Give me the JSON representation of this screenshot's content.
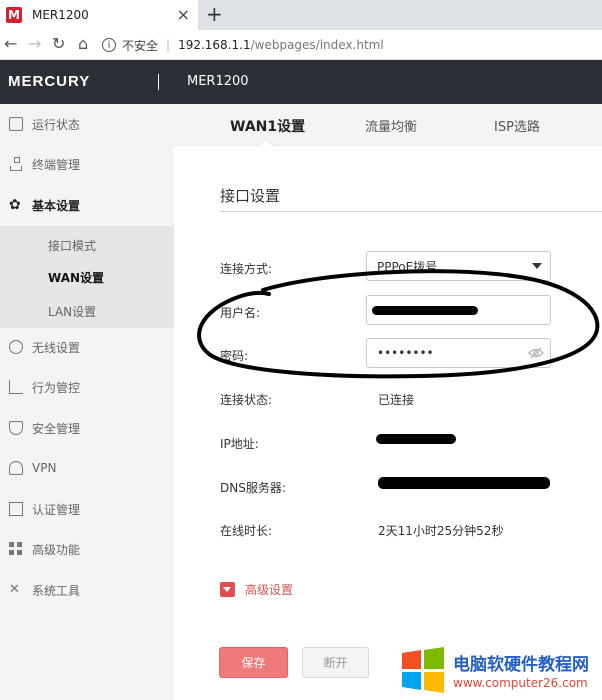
{
  "browser": {
    "tab_title": "MER1200",
    "tab_favicon": "M",
    "close_glyph": "×",
    "new_tab_glyph": "+",
    "security_label": "不安全",
    "url_host": "192.168.1.1",
    "url_path": "/webpages/index.html"
  },
  "header": {
    "logo": "MERCURY",
    "model": "MER1200"
  },
  "sidebar": {
    "items": [
      {
        "label": "运行状态",
        "icon": "monitor-icon"
      },
      {
        "label": "终端管理",
        "icon": "network-icon"
      },
      {
        "label": "基本设置",
        "icon": "gear-icon"
      },
      {
        "label": "无线设置",
        "icon": "wifi-icon"
      },
      {
        "label": "行为管控",
        "icon": "chart-icon"
      },
      {
        "label": "安全管理",
        "icon": "shield-icon"
      },
      {
        "label": "VPN",
        "icon": "vpn-icon"
      },
      {
        "label": "认证管理",
        "icon": "auth-icon"
      },
      {
        "label": "高级功能",
        "icon": "grid-icon"
      },
      {
        "label": "系统工具",
        "icon": "tools-icon"
      }
    ],
    "subitems": [
      {
        "label": "接口模式"
      },
      {
        "label": "WAN设置"
      },
      {
        "label": "LAN设置"
      }
    ]
  },
  "content_tabs": [
    {
      "label": "WAN1设置"
    },
    {
      "label": "流量均衡"
    },
    {
      "label": "ISP选路"
    }
  ],
  "form": {
    "section_title": "接口设置",
    "connection_type_label": "连接方式:",
    "connection_type_value": "PPPoE拨号",
    "username_label": "用户名:",
    "password_label": "密码:",
    "password_value": "••••••••",
    "status_label": "连接状态:",
    "status_value": "已连接",
    "ip_label": "IP地址:",
    "dns_label": "DNS服务器:",
    "uptime_label": "在线时长:",
    "uptime_value": "2天11小时25分钟52秒",
    "advanced_label": "高级设置",
    "save_label": "保存",
    "disconnect_label": "断开"
  },
  "watermark": {
    "text": "电脑软硬件教程网",
    "url": "www.computer26.com"
  }
}
